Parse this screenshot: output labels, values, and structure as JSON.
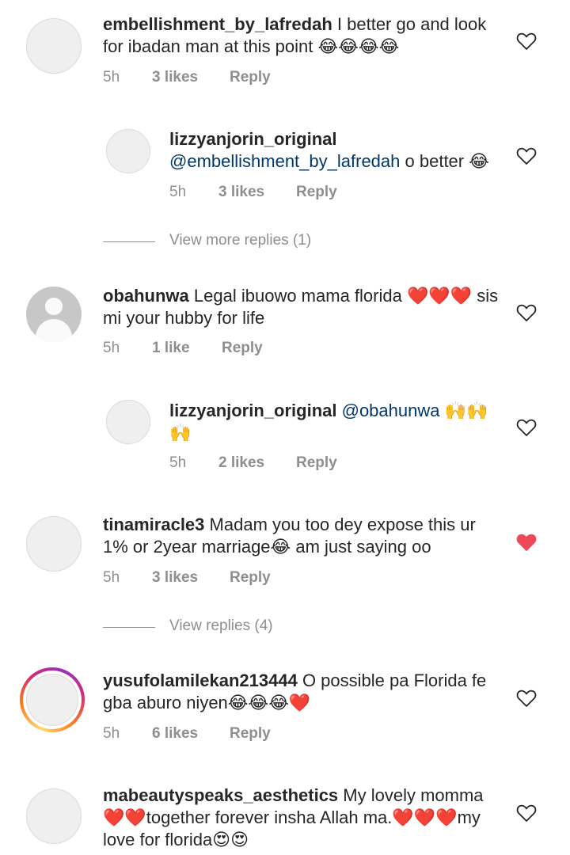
{
  "comments": [
    {
      "username": "embellishment_by_lafredah",
      "text": "I better go and look for ibadan man at this point 😂😂😂😂",
      "time": "5h",
      "likes": "3 likes",
      "reply": "Reply",
      "liked": false
    },
    {
      "username": "lizzyanjorin_original",
      "mention": "@embellishment_by_lafredah",
      "text": "o better 😂",
      "time": "5h",
      "likes": "3 likes",
      "reply": "Reply",
      "liked": false
    },
    {
      "username": "obahunwa",
      "text": "Legal ibuowo mama florida ❤️❤️❤️ sis mi your hubby  for life",
      "time": "5h",
      "likes": "1 like",
      "reply": "Reply",
      "liked": false
    },
    {
      "username": "lizzyanjorin_original",
      "mention": "@obahunwa",
      "text": "🙌🙌🙌",
      "time": "5h",
      "likes": "2 likes",
      "reply": "Reply",
      "liked": false
    },
    {
      "username": "tinamiracle3",
      "text": "Madam you too dey expose this ur 1% or 2year marriage😂 am just saying oo",
      "time": "5h",
      "likes": "3 likes",
      "reply": "Reply",
      "liked": true
    },
    {
      "username": "yusufolamilekan213444",
      "text": "O possible pa Florida fe gba aburo niyen😂😂😂❤️",
      "time": "5h",
      "likes": "6 likes",
      "reply": "Reply",
      "liked": false
    },
    {
      "username": "mabeautyspeaks_aesthetics",
      "text": "My lovely momma ❤️❤️together forever insha Allah ma.❤️❤️❤️my love for florida😍😍",
      "liked": false
    }
  ],
  "view_more_replies": [
    "View more replies (1)",
    "View replies (4)"
  ],
  "colors": {
    "liked_heart": "#ed4956",
    "meta_gray": "#8e8e8e",
    "mention_blue": "#00376b"
  },
  "icons": {
    "like": "heart-outline-icon",
    "liked": "heart-filled-icon"
  }
}
